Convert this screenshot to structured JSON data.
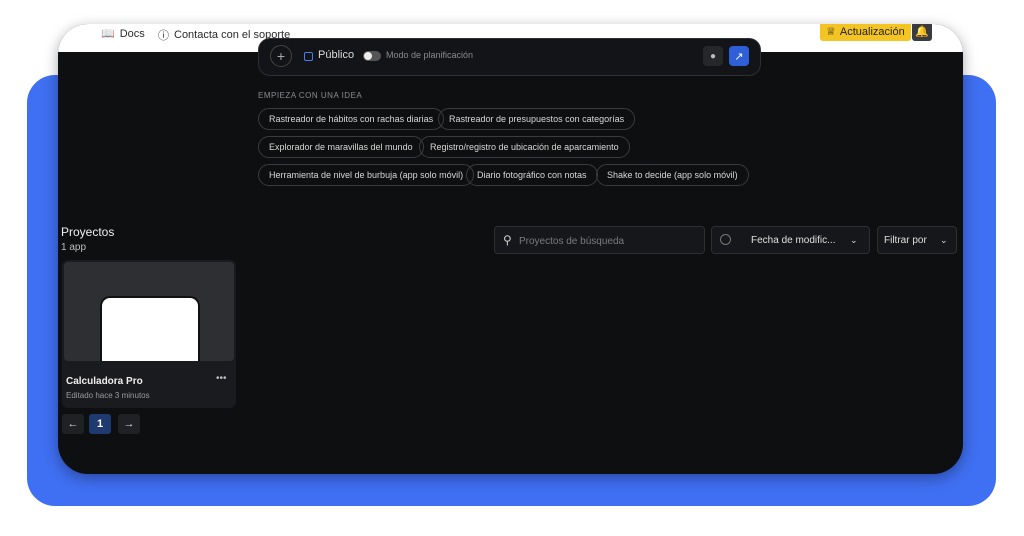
{
  "topbar": {
    "docs_label": "Docs",
    "support_label": "Contacta con el soporte",
    "upgrade_label": "Actualización"
  },
  "prompt": {
    "public_label": "Público",
    "planning_label": "Modo de planificación"
  },
  "ideas": {
    "title": "EMPIEZA CON UNA IDEA",
    "chips": [
      "Rastreador de hábitos con rachas diarias",
      "Rastreador de presupuestos con categorías",
      "Explorador de maravillas del mundo",
      "Registro/registro de ubicación de aparcamiento",
      "Herramienta de nivel de burbuja (app solo móvil)",
      "Diario fotográfico con notas",
      "Shake to decide (app solo móvil)"
    ]
  },
  "projects": {
    "title": "Proyectos",
    "count": "1 app",
    "search_placeholder": "Proyectos de búsqueda",
    "sort_label": "Fecha de  modific...",
    "filter_label": "Filtrar por",
    "cards": [
      {
        "name": "Calculadora Pro",
        "edited": "Editado hace 3 minutos"
      }
    ],
    "pagination": {
      "current_page": "1"
    }
  },
  "colors": {
    "accent": "#3f6ff2",
    "upgrade": "#f4c522",
    "window_bg": "#0e0f11"
  }
}
